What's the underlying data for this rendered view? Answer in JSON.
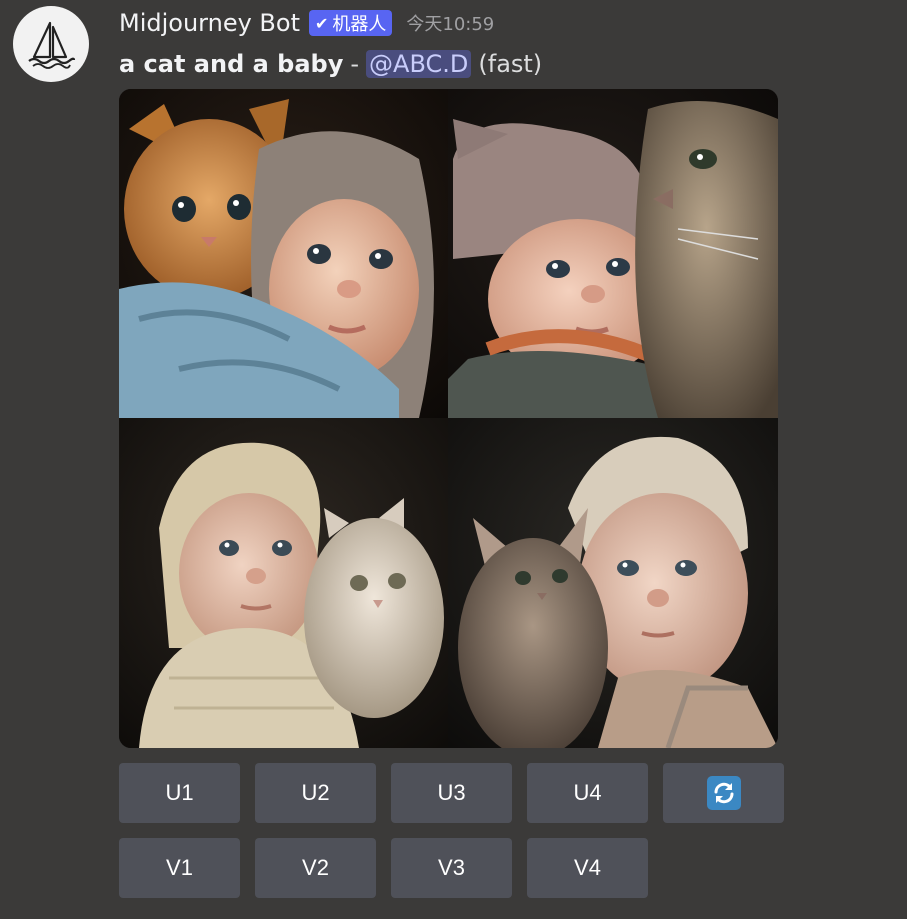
{
  "message": {
    "username": "Midjourney Bot",
    "bot_tag": "机器人",
    "timestamp": "今天10:59",
    "prompt": "a cat and a baby",
    "separator": "-",
    "mention": "@ABC.D",
    "speed": "(fast)"
  },
  "images": [
    {
      "icon": "cat-baby-image-1"
    },
    {
      "icon": "cat-baby-image-2"
    },
    {
      "icon": "cat-baby-image-3"
    },
    {
      "icon": "cat-baby-image-4"
    }
  ],
  "buttons": {
    "upscale": [
      "U1",
      "U2",
      "U3",
      "U4"
    ],
    "variation": [
      "V1",
      "V2",
      "V3",
      "V4"
    ],
    "reroll_icon": "refresh-icon"
  },
  "colors": {
    "background": "#3b3a39",
    "bot_tag": "#5865f2",
    "button": "#4f5159",
    "mention_bg": "#4a4d7e",
    "refresh_icon": "#3b88c3"
  }
}
